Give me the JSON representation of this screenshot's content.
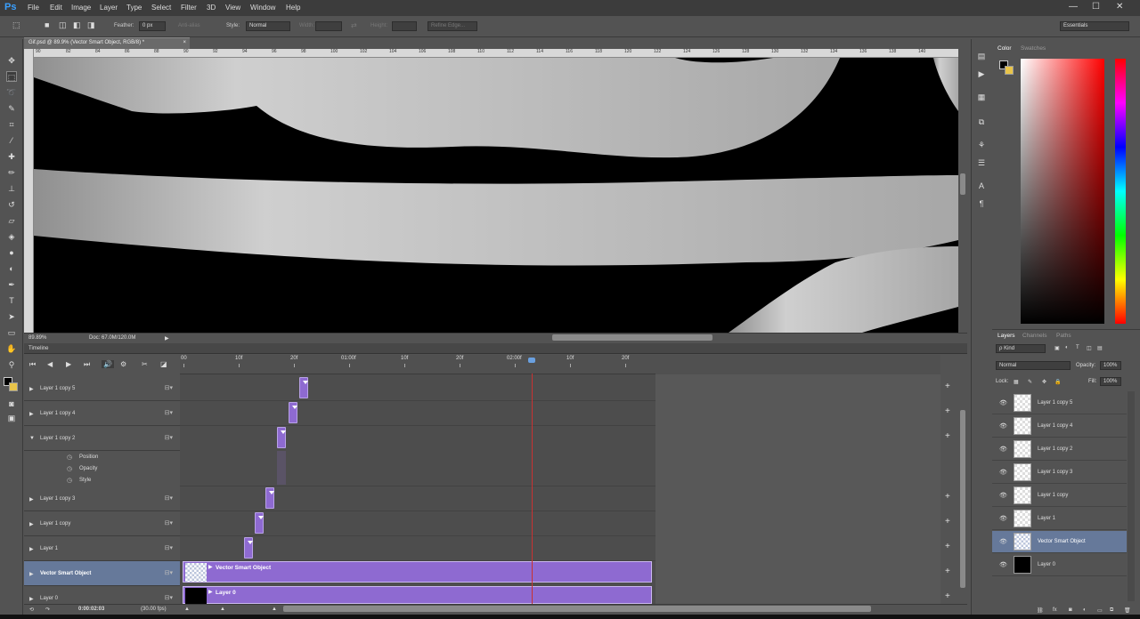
{
  "app": {
    "logo": "Ps",
    "minimize": "—",
    "maximize": "☐",
    "close": "✕"
  },
  "menu": [
    "File",
    "Edit",
    "Image",
    "Layer",
    "Type",
    "Select",
    "Filter",
    "3D",
    "View",
    "Window",
    "Help"
  ],
  "options": {
    "feather_label": "Feather:",
    "feather_value": "0 px",
    "antialias": "Anti-alias",
    "style_label": "Style:",
    "style_value": "Normal",
    "width_label": "Width:",
    "height_label": "Height:",
    "refine": "Refine Edge...",
    "workspace": "Essentials"
  },
  "document": {
    "tab_title": "Gif.psd @ 89.9% (Vector Smart Object, RGB/8) *",
    "zoom": "89.89%",
    "doc_size": "Doc: 67.0M/120.0M",
    "ruler_ticks": [
      "90",
      "82",
      "84",
      "86",
      "88",
      "90",
      "92",
      "94",
      "96",
      "98",
      "100",
      "102",
      "104",
      "106",
      "108",
      "110",
      "112",
      "114",
      "116",
      "118",
      "120",
      "122",
      "124",
      "126",
      "128",
      "130",
      "132",
      "134",
      "136",
      "138",
      "140"
    ]
  },
  "timeline": {
    "title": "Timeline",
    "ruler": [
      "00",
      "10f",
      "20f",
      "01:00f",
      "10f",
      "20f",
      "02:00f",
      "10f",
      "20f"
    ],
    "layers": [
      {
        "name": "Layer 1 copy 5",
        "expanded": false
      },
      {
        "name": "Layer 1 copy 4",
        "expanded": false
      },
      {
        "name": "Layer 1 copy 2",
        "expanded": true
      },
      {
        "name": "Layer 1 copy 3",
        "expanded": false
      },
      {
        "name": "Layer 1 copy",
        "expanded": false
      },
      {
        "name": "Layer 1",
        "expanded": false
      },
      {
        "name": "Vector Smart Object",
        "expanded": false,
        "selected": true
      },
      {
        "name": "Layer 0",
        "expanded": false
      }
    ],
    "properties": [
      "Position",
      "Opacity",
      "Style"
    ],
    "clip_vso": "Vector Smart Object",
    "clip_layer0": "Layer 0",
    "timecode": "0:00:02:03",
    "fps": "(30.00 fps)"
  },
  "color_panel": {
    "tabs": [
      "Color",
      "Swatches"
    ]
  },
  "layers_panel": {
    "tabs": [
      "Layers",
      "Channels",
      "Paths"
    ],
    "kind": "ρ Kind",
    "blend": "Normal",
    "opacity_label": "Opacity:",
    "opacity_value": "100%",
    "lock_label": "Lock:",
    "fill_label": "Fill:",
    "fill_value": "100%",
    "layers": [
      {
        "name": "Layer 1 copy 5"
      },
      {
        "name": "Layer 1 copy 4"
      },
      {
        "name": "Layer 1 copy 2"
      },
      {
        "name": "Layer 1 copy 3"
      },
      {
        "name": "Layer 1 copy"
      },
      {
        "name": "Layer 1"
      },
      {
        "name": "Vector Smart Object",
        "selected": true
      },
      {
        "name": "Layer 0"
      }
    ],
    "footer_icons": [
      "link-icon",
      "fx-icon",
      "mask-icon",
      "adjustment-icon",
      "folder-icon",
      "new-layer-icon",
      "trash-icon"
    ]
  }
}
